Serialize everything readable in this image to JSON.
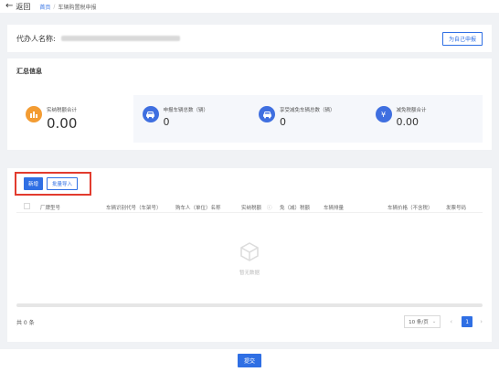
{
  "topbar": {
    "back_label": "返回",
    "breadcrumb": [
      "首页",
      "车辆购置税申报"
    ]
  },
  "agent": {
    "label": "代办人名称:",
    "self_button": "为自己申报"
  },
  "summary": {
    "title": "汇总信息",
    "items": [
      {
        "label": "实纳税额合计",
        "value": "0.00",
        "icon": "bar-chart-icon",
        "color": "#f39c33"
      },
      {
        "label": "申报车辆总数（辆）",
        "value": "0",
        "icon": "car-icon",
        "color": "#3f6fe0"
      },
      {
        "label": "享受减免车辆总数（辆）",
        "value": "0",
        "icon": "car-discount-icon",
        "color": "#3f6fe0"
      },
      {
        "label": "减免税额合计",
        "value": "0.00",
        "icon": "yen-icon",
        "color": "#3f6fe0"
      }
    ]
  },
  "table": {
    "new_button": "新增",
    "import_button": "批量导入",
    "columns": [
      "厂牌型号",
      "车辆识别代号（车架号）",
      "购车人（单位）名称",
      "实纳税额",
      "免（减）税额",
      "车辆排量",
      "车辆价格（不含税）",
      "发票号码"
    ],
    "empty_text": "暂无数据"
  },
  "pagination": {
    "total": "共 0 条",
    "page_size": "10 条/页",
    "current_page": "1"
  },
  "footer": {
    "submit": "提交"
  },
  "colors": {
    "primary": "#2f6fe4",
    "highlight": "#e23b2e"
  }
}
